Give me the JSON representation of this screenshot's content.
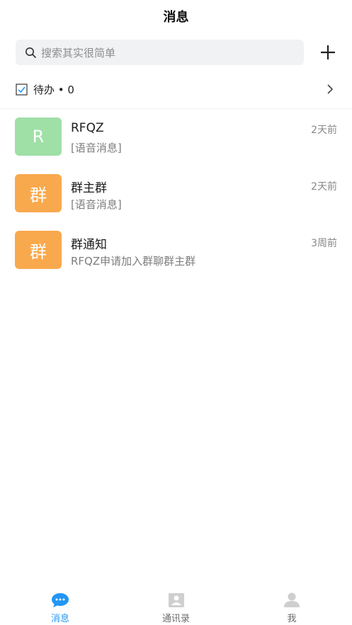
{
  "header": {
    "title": "消息"
  },
  "search": {
    "placeholder": "搜索其实很简单",
    "plus_icon": "plus-icon"
  },
  "todo": {
    "label": "待办 • 0"
  },
  "colors": {
    "accent": "#2196f3",
    "avatar_green": "#9fe0a7",
    "avatar_orange": "#f9a94d"
  },
  "conversations": [
    {
      "avatar": "R",
      "avatar_color": "#9fe0a7",
      "name": "RFQZ",
      "preview": "[语音消息]",
      "time": "2天前"
    },
    {
      "avatar": "群",
      "avatar_color": "#f9a94d",
      "name": "群主群",
      "preview": "[语音消息]",
      "time": "2天前"
    },
    {
      "avatar": "群",
      "avatar_color": "#f9a94d",
      "name": "群通知",
      "preview": "RFQZ申请加入群聊群主群",
      "time": "3周前"
    }
  ],
  "tabs": [
    {
      "label": "消息",
      "icon": "chat-bubble-icon",
      "active": true
    },
    {
      "label": "通讯录",
      "icon": "contacts-icon",
      "active": false
    },
    {
      "label": "我",
      "icon": "person-icon",
      "active": false
    }
  ]
}
